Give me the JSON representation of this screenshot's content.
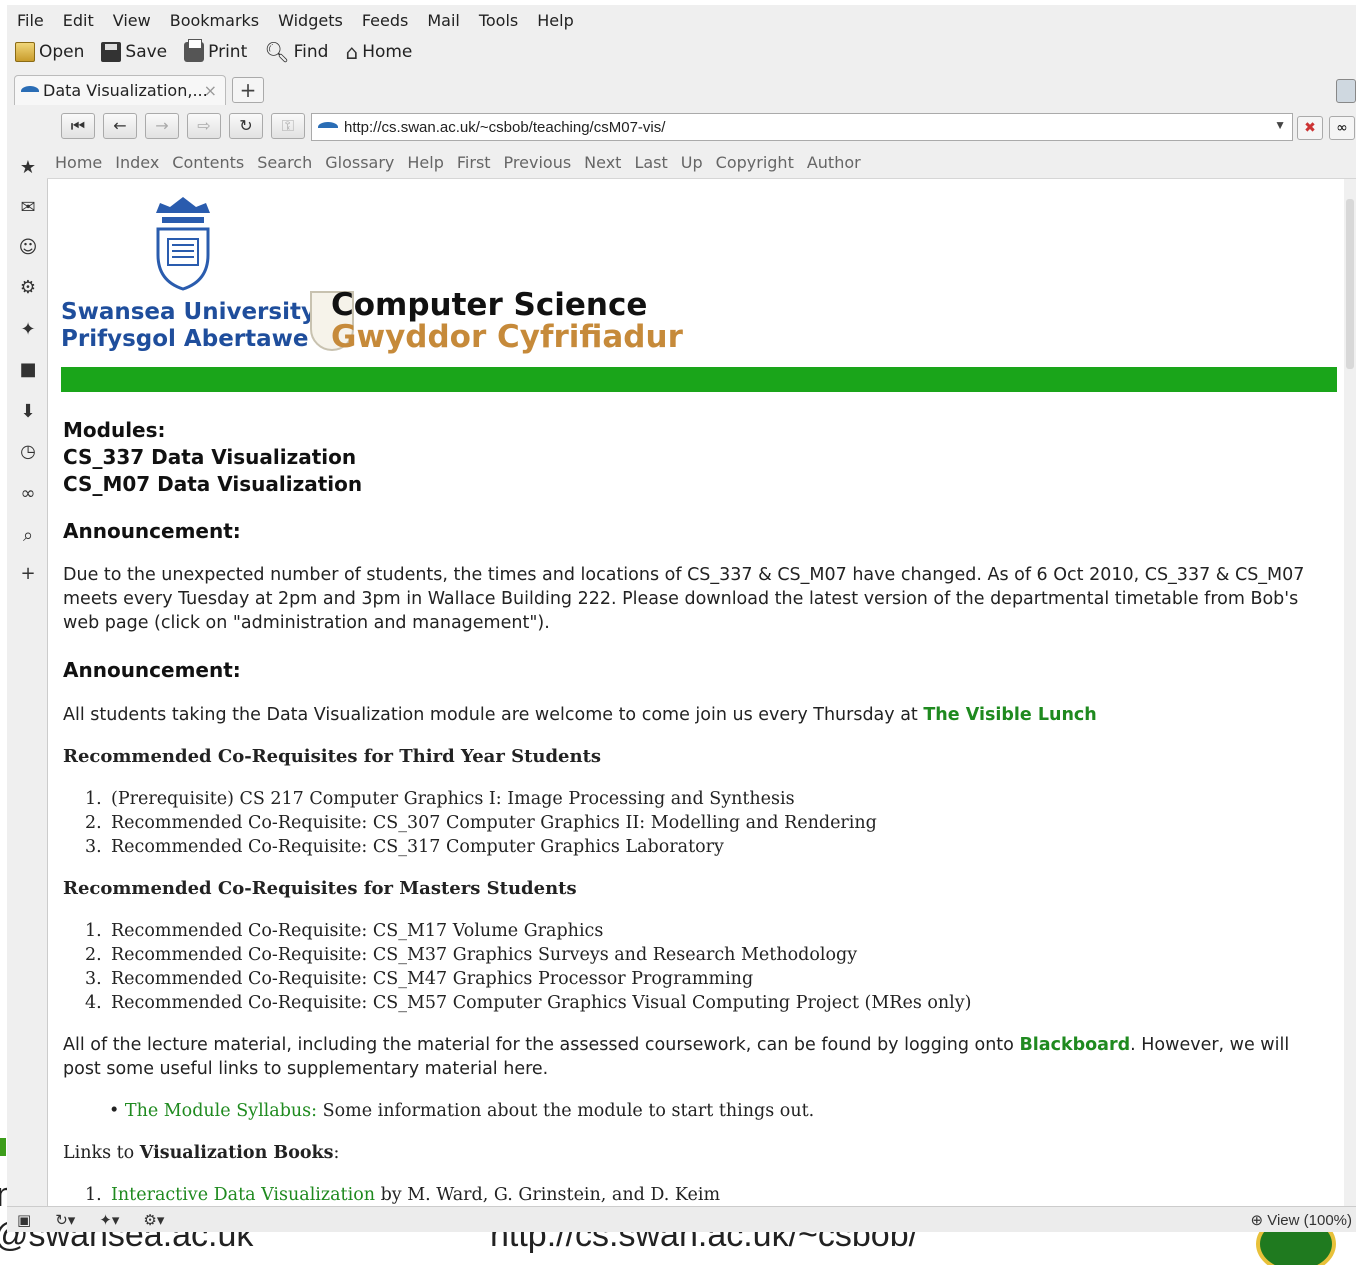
{
  "slide": {
    "email_text": "@swansea.ac.uk",
    "url_text": "http://cs.swan.ac.uk/~csbob/",
    "n_text": "n"
  },
  "menu": [
    "File",
    "Edit",
    "View",
    "Bookmarks",
    "Widgets",
    "Feeds",
    "Mail",
    "Tools",
    "Help"
  ],
  "toolbar": {
    "open": "Open",
    "save": "Save",
    "print": "Print",
    "find": "Find",
    "home": "Home"
  },
  "tab": {
    "title": "Data Visualization,...",
    "close": "×",
    "new": "+"
  },
  "address": {
    "url": "http://cs.swan.ac.uk/~csbob/teaching/csM07-vis/"
  },
  "linkbar": [
    "Home",
    "Index",
    "Contents",
    "Search",
    "Glossary",
    "Help",
    "First",
    "Previous",
    "Next",
    "Last",
    "Up",
    "Copyright",
    "Author"
  ],
  "status": {
    "zoom": "View (100%)"
  },
  "page": {
    "uni_en": "Swansea University",
    "uni_cy": "Prifysgol Abertawe",
    "dept_en": "Computer Science",
    "dept_cy": "Gwyddor Cyfrifiadur",
    "modules_label": "Modules:",
    "module1": "CS_337 Data Visualization",
    "module2": "CS_M07 Data Visualization",
    "ann1_title": "Announcement:",
    "ann1_text": "Due to the unexpected number of students, the times and locations of CS_337 & CS_M07 have changed. As of 6 Oct 2010, CS_337 & CS_M07 meets every Tuesday at 2pm and 3pm in Wallace Building 222. Please download the latest version of the departmental timetable from Bob's web page (click on \"administration and management\").",
    "ann2_title": "Announcement:",
    "ann2_text": "All students taking the Data Visualization module are welcome to come join us every Thursday at",
    "ann2_link": "The Visible Lunch",
    "third_year_title": "Recommended Co-Requisites for Third Year Students",
    "third_year": [
      "(Prerequisite) CS 217 Computer Graphics I: Image Processing and Synthesis",
      "Recommended Co-Requisite: CS_307 Computer Graphics II: Modelling and Rendering",
      "Recommended Co-Requisite: CS_317 Computer Graphics Laboratory"
    ],
    "masters_title": "Recommended Co-Requisites for Masters Students",
    "masters": [
      "Recommended Co-Requisite: CS_M17 Volume Graphics",
      "Recommended Co-Requisite: CS_M37 Graphics Surveys and Research Methodology",
      "Recommended Co-Requisite: CS_M47 Graphics Processor Programming",
      "Recommended Co-Requisite: CS_M57 Computer Graphics Visual Computing Project (MRes only)"
    ],
    "lecture_pre": "All of the lecture material, including the material for the assessed coursework, can be found by logging onto",
    "lecture_link": "Blackboard",
    "lecture_post": ". However, we will post some useful links to supplementary material here.",
    "syllabus_link": "The Module Syllabus:",
    "syllabus_text": "Some information about the module to start things out.",
    "books_pre": "Links to",
    "books_bold": "Visualization Books",
    "books_post": ":",
    "book1_link": "Interactive Data Visualization",
    "book1_text": "by M. Ward, G. Grinstein, and D. Keim"
  }
}
